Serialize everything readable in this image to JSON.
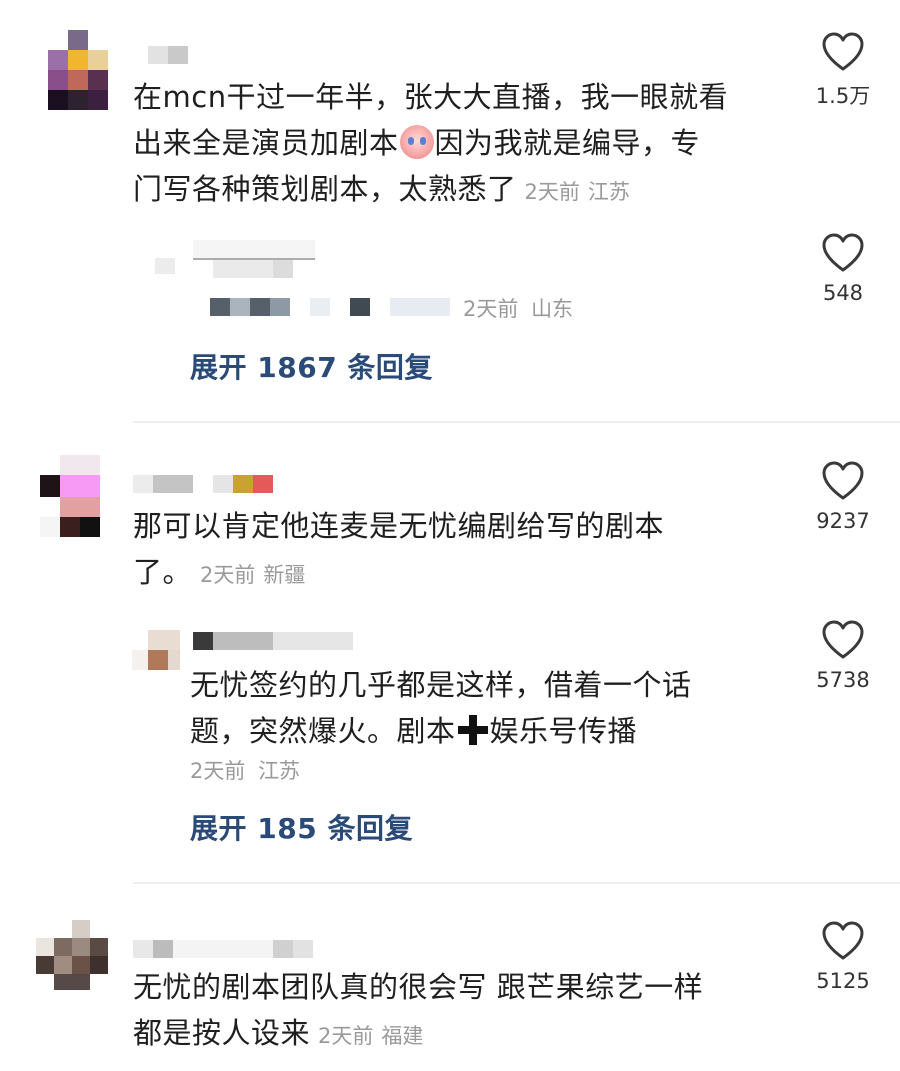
{
  "comments": [
    {
      "text_line1": "在mcn干过一年半，张大大直播，我一眼就看",
      "text_line2a": "出来全是演员加剧本",
      "text_line2b": "因为我就是编导，专",
      "text_line3": "门写各种策划剧本，太熟悉了",
      "time": "2天前",
      "location": "江苏",
      "likes": "1.5万",
      "reply": {
        "time": "2天前",
        "location": "山东",
        "likes": "548"
      },
      "expand_label": "展开 1867 条回复"
    },
    {
      "text_line1": "那可以肯定他连麦是无忧编剧给写的剧本",
      "text_line2": "了。",
      "time": "2天前",
      "location": "新疆",
      "likes": "9237",
      "reply": {
        "text_line1": "无忧签约的几乎都是这样，借着一个话",
        "text_line2a": "题，突然爆火。剧本",
        "text_line2b": "娱乐号传播",
        "time": "2天前",
        "location": "江苏",
        "likes": "5738"
      },
      "expand_label": "展开 185 条回复"
    },
    {
      "text_line1": "无忧的剧本团队真的很会写 跟芒果综艺一样",
      "text_line2": "都是按人设来",
      "time": "2天前",
      "location": "福建",
      "likes": "5125"
    }
  ],
  "icons": {
    "like": "heart-outline-icon",
    "emoji": "crying-face-emoji-icon",
    "plus": "heavy-plus-icon"
  },
  "colors": {
    "expand_link": "#2a4a78",
    "meta": "#9a9a9a",
    "text": "#1f1f1f"
  }
}
